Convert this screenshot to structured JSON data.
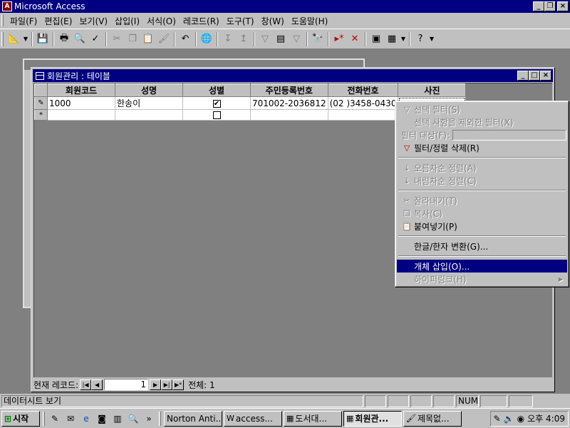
{
  "app": {
    "title": "Microsoft Access",
    "caption_buttons": {
      "minimize": "_",
      "restore": "❐",
      "close": "×"
    }
  },
  "menubar": {
    "items": [
      "파일(F)",
      "편집(E)",
      "보기(V)",
      "삽입(I)",
      "서식(O)",
      "레코드(R)",
      "도구(T)",
      "창(W)",
      "도움말(H)"
    ]
  },
  "table_window": {
    "title": "회원관리 : 테이블",
    "columns": [
      "회원코드",
      "성명",
      "성별",
      "주민등록번호",
      "전화번호",
      "사진"
    ],
    "rows": [
      {
        "selector": "✎",
        "code": "1000",
        "name": "한송이",
        "gender_checked": true,
        "ssn": "701002-2036812",
        "phone": "(02 )3458-0430",
        "photo": ""
      },
      {
        "selector": "*",
        "code": "",
        "name": "",
        "gender_checked": false,
        "ssn": "",
        "phone": "",
        "photo": ""
      }
    ]
  },
  "navigation": {
    "label": "현재 레코드:",
    "current": "1",
    "total_label": "전체: 1",
    "buttons": {
      "first": "|◀",
      "prev": "◀",
      "next": "▶",
      "last": "▶|",
      "new": "▶*"
    }
  },
  "context_menu": {
    "items": [
      {
        "label": "선택 필터(S)",
        "icon": "filter-selection-icon",
        "glyph": "▽",
        "disabled": true
      },
      {
        "label": "선택 사항을 제외한 필터(X)",
        "icon": "",
        "glyph": "",
        "disabled": true
      },
      {
        "label": "필터 대상(F):",
        "icon": "",
        "glyph": "",
        "disabled": true,
        "has_input": true
      },
      {
        "label": "필터/정렬 삭제(R)",
        "icon": "remove-filter-icon",
        "glyph": "▽",
        "disabled": false
      },
      {
        "sep": true
      },
      {
        "label": "오름차순 정렬(A)",
        "icon": "sort-ascending-icon",
        "glyph": "↓",
        "disabled": true
      },
      {
        "label": "내림차순 정렬(C)",
        "icon": "sort-descending-icon",
        "glyph": "↓",
        "disabled": true
      },
      {
        "sep": true
      },
      {
        "label": "잘라내기(T)",
        "icon": "cut-icon",
        "glyph": "✂",
        "disabled": true
      },
      {
        "label": "복사(C)",
        "icon": "copy-icon",
        "glyph": "❐",
        "disabled": true
      },
      {
        "label": "붙여넣기(P)",
        "icon": "paste-icon",
        "glyph": "📋",
        "disabled": false
      },
      {
        "sep": true
      },
      {
        "label": "한글/한자 변환(G)...",
        "icon": "",
        "glyph": "",
        "disabled": false
      },
      {
        "sep": true
      },
      {
        "label": "개체 삽입(O)...",
        "icon": "",
        "glyph": "",
        "disabled": false,
        "highlighted": true
      },
      {
        "label": "하이퍼링크(H)",
        "icon": "",
        "glyph": "",
        "disabled": true,
        "submenu": true
      }
    ]
  },
  "statusbar": {
    "text": "데이터시트 보기",
    "num": "NUM"
  },
  "taskbar": {
    "start_label": "시작",
    "tasks": [
      {
        "label": "Norton Anti...",
        "icon": "norton-icon",
        "active": false
      },
      {
        "label": "access...",
        "icon": "word-doc-icon",
        "active": false
      },
      {
        "label": "도서대...",
        "icon": "table-icon",
        "active": false
      },
      {
        "label": "회원관...",
        "icon": "table-icon",
        "active": true
      },
      {
        "label": "제목없...",
        "icon": "paint-icon",
        "active": false
      }
    ],
    "clock": "오후 4:09"
  }
}
